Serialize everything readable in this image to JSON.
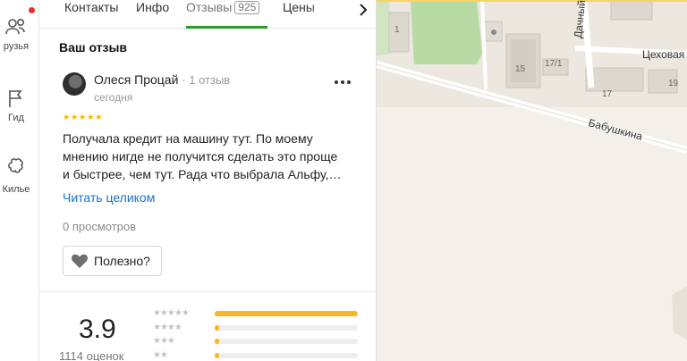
{
  "sidebar": {
    "items": [
      {
        "label": "рузья",
        "icon": "friends-icon"
      },
      {
        "label": "Гид",
        "icon": "guide-flag-icon"
      },
      {
        "label": "Килье",
        "icon": "housing-icon"
      }
    ]
  },
  "tabs": {
    "items": [
      {
        "label": "Контакты"
      },
      {
        "label": "Инфо"
      },
      {
        "label": "Отзывы",
        "count": "925"
      },
      {
        "label": "Цены"
      }
    ],
    "active": "Отзывы"
  },
  "review": {
    "section_title": "Ваш отзыв",
    "author": "Олеся Процай",
    "author_meta": "· 1 отзыв",
    "date": "сегодня",
    "rating": 5,
    "text_lines": [
      "Получала кредит на машину тут. По моему",
      "мнению нигде не получится сделать это проще",
      "и быстрее, чем тут. Рада что выбрала Альфу,…"
    ],
    "read_more": "Читать целиком",
    "views": "0 просмотров",
    "useful_label": "Полезно?"
  },
  "summary": {
    "rating": "3.9",
    "ratings_count": "1114 оценок",
    "distribution": [
      {
        "stars": 5,
        "fraction": 1.0
      },
      {
        "stars": 4,
        "fraction": 0.02
      },
      {
        "stars": 3,
        "fraction": 0.02
      },
      {
        "stars": 2,
        "fraction": 0.02
      }
    ]
  },
  "map": {
    "streets": [
      "Бабушкина",
      "Цеховая",
      "Дачный п"
    ],
    "house_numbers": [
      "1",
      "15",
      "17/1",
      "17",
      "19"
    ]
  },
  "colors": {
    "accent_green": "#2a9d2a",
    "link_blue": "#1a73c8",
    "star_yellow": "#f5b400",
    "bar_orange": "#f8b42a"
  }
}
